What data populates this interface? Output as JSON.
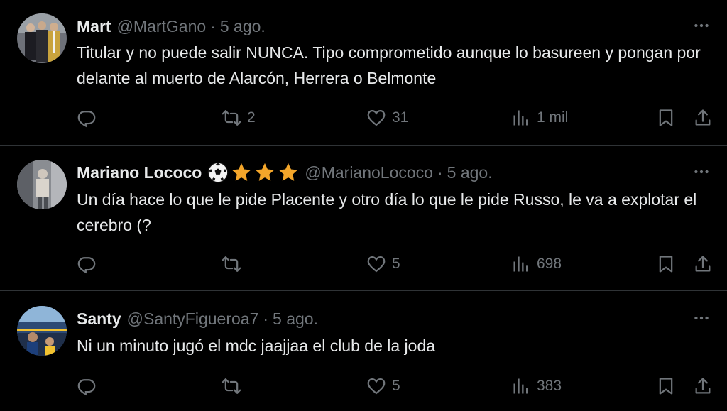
{
  "colors": {
    "background": "#000000",
    "text": "#e7e9ea",
    "muted": "#71767b",
    "divider": "#2f3336",
    "star": "#f4a62a"
  },
  "tweets": [
    {
      "name": "Mart",
      "handle": "@MartGano",
      "separator": "·",
      "time": "5 ago.",
      "text": "Titular y no puede salir NUNCA. Tipo comprometido aunque lo basureen y pongan por delante al muerto de Alarcón, Herrera o Belmonte",
      "replies": "",
      "retweets": "2",
      "likes": "31",
      "views": "1 mil",
      "avatar": "photo-three-men-suits"
    },
    {
      "name": "Mariano Lococo",
      "badges": [
        "soccer-ball-icon",
        "star-icon",
        "star-icon",
        "star-icon"
      ],
      "handle": "@MarianoLococo",
      "separator": "·",
      "time": "5 ago.",
      "text": "Un día hace lo que le pide Placente y otro día lo que le pide Russo, le va a explotar el cerebro (?",
      "replies": "",
      "retweets": "",
      "likes": "5",
      "views": "698",
      "avatar": "photo-person-standing"
    },
    {
      "name": "Santy",
      "handle": "@SantyFigueroa7",
      "separator": "·",
      "time": "5 ago.",
      "text": "Ni un minuto jugó el mdc jaajjaa el club de la joda",
      "replies": "",
      "retweets": "",
      "likes": "5",
      "views": "383",
      "avatar": "photo-stadium-kid"
    }
  ]
}
